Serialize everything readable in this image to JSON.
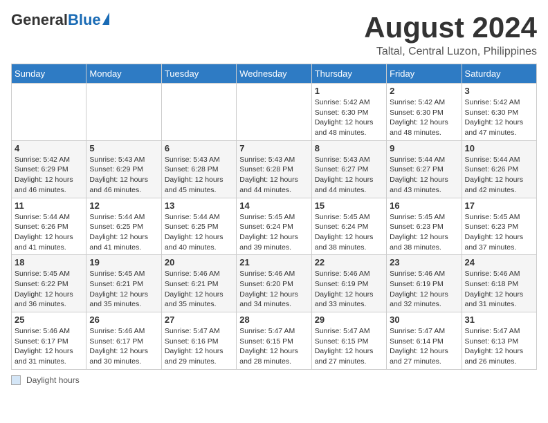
{
  "header": {
    "logo_general": "General",
    "logo_blue": "Blue",
    "month_title": "August 2024",
    "location": "Taltal, Central Luzon, Philippines"
  },
  "calendar": {
    "days_of_week": [
      "Sunday",
      "Monday",
      "Tuesday",
      "Wednesday",
      "Thursday",
      "Friday",
      "Saturday"
    ],
    "weeks": [
      [
        {
          "day": "",
          "info": ""
        },
        {
          "day": "",
          "info": ""
        },
        {
          "day": "",
          "info": ""
        },
        {
          "day": "",
          "info": ""
        },
        {
          "day": "1",
          "info": "Sunrise: 5:42 AM\nSunset: 6:30 PM\nDaylight: 12 hours\nand 48 minutes."
        },
        {
          "day": "2",
          "info": "Sunrise: 5:42 AM\nSunset: 6:30 PM\nDaylight: 12 hours\nand 48 minutes."
        },
        {
          "day": "3",
          "info": "Sunrise: 5:42 AM\nSunset: 6:30 PM\nDaylight: 12 hours\nand 47 minutes."
        }
      ],
      [
        {
          "day": "4",
          "info": "Sunrise: 5:42 AM\nSunset: 6:29 PM\nDaylight: 12 hours\nand 46 minutes."
        },
        {
          "day": "5",
          "info": "Sunrise: 5:43 AM\nSunset: 6:29 PM\nDaylight: 12 hours\nand 46 minutes."
        },
        {
          "day": "6",
          "info": "Sunrise: 5:43 AM\nSunset: 6:28 PM\nDaylight: 12 hours\nand 45 minutes."
        },
        {
          "day": "7",
          "info": "Sunrise: 5:43 AM\nSunset: 6:28 PM\nDaylight: 12 hours\nand 44 minutes."
        },
        {
          "day": "8",
          "info": "Sunrise: 5:43 AM\nSunset: 6:27 PM\nDaylight: 12 hours\nand 44 minutes."
        },
        {
          "day": "9",
          "info": "Sunrise: 5:44 AM\nSunset: 6:27 PM\nDaylight: 12 hours\nand 43 minutes."
        },
        {
          "day": "10",
          "info": "Sunrise: 5:44 AM\nSunset: 6:26 PM\nDaylight: 12 hours\nand 42 minutes."
        }
      ],
      [
        {
          "day": "11",
          "info": "Sunrise: 5:44 AM\nSunset: 6:26 PM\nDaylight: 12 hours\nand 41 minutes."
        },
        {
          "day": "12",
          "info": "Sunrise: 5:44 AM\nSunset: 6:25 PM\nDaylight: 12 hours\nand 41 minutes."
        },
        {
          "day": "13",
          "info": "Sunrise: 5:44 AM\nSunset: 6:25 PM\nDaylight: 12 hours\nand 40 minutes."
        },
        {
          "day": "14",
          "info": "Sunrise: 5:45 AM\nSunset: 6:24 PM\nDaylight: 12 hours\nand 39 minutes."
        },
        {
          "day": "15",
          "info": "Sunrise: 5:45 AM\nSunset: 6:24 PM\nDaylight: 12 hours\nand 38 minutes."
        },
        {
          "day": "16",
          "info": "Sunrise: 5:45 AM\nSunset: 6:23 PM\nDaylight: 12 hours\nand 38 minutes."
        },
        {
          "day": "17",
          "info": "Sunrise: 5:45 AM\nSunset: 6:23 PM\nDaylight: 12 hours\nand 37 minutes."
        }
      ],
      [
        {
          "day": "18",
          "info": "Sunrise: 5:45 AM\nSunset: 6:22 PM\nDaylight: 12 hours\nand 36 minutes."
        },
        {
          "day": "19",
          "info": "Sunrise: 5:45 AM\nSunset: 6:21 PM\nDaylight: 12 hours\nand 35 minutes."
        },
        {
          "day": "20",
          "info": "Sunrise: 5:46 AM\nSunset: 6:21 PM\nDaylight: 12 hours\nand 35 minutes."
        },
        {
          "day": "21",
          "info": "Sunrise: 5:46 AM\nSunset: 6:20 PM\nDaylight: 12 hours\nand 34 minutes."
        },
        {
          "day": "22",
          "info": "Sunrise: 5:46 AM\nSunset: 6:19 PM\nDaylight: 12 hours\nand 33 minutes."
        },
        {
          "day": "23",
          "info": "Sunrise: 5:46 AM\nSunset: 6:19 PM\nDaylight: 12 hours\nand 32 minutes."
        },
        {
          "day": "24",
          "info": "Sunrise: 5:46 AM\nSunset: 6:18 PM\nDaylight: 12 hours\nand 31 minutes."
        }
      ],
      [
        {
          "day": "25",
          "info": "Sunrise: 5:46 AM\nSunset: 6:17 PM\nDaylight: 12 hours\nand 31 minutes."
        },
        {
          "day": "26",
          "info": "Sunrise: 5:46 AM\nSunset: 6:17 PM\nDaylight: 12 hours\nand 30 minutes."
        },
        {
          "day": "27",
          "info": "Sunrise: 5:47 AM\nSunset: 6:16 PM\nDaylight: 12 hours\nand 29 minutes."
        },
        {
          "day": "28",
          "info": "Sunrise: 5:47 AM\nSunset: 6:15 PM\nDaylight: 12 hours\nand 28 minutes."
        },
        {
          "day": "29",
          "info": "Sunrise: 5:47 AM\nSunset: 6:15 PM\nDaylight: 12 hours\nand 27 minutes."
        },
        {
          "day": "30",
          "info": "Sunrise: 5:47 AM\nSunset: 6:14 PM\nDaylight: 12 hours\nand 27 minutes."
        },
        {
          "day": "31",
          "info": "Sunrise: 5:47 AM\nSunset: 6:13 PM\nDaylight: 12 hours\nand 26 minutes."
        }
      ]
    ]
  },
  "footer": {
    "daylight_label": "Daylight hours"
  }
}
